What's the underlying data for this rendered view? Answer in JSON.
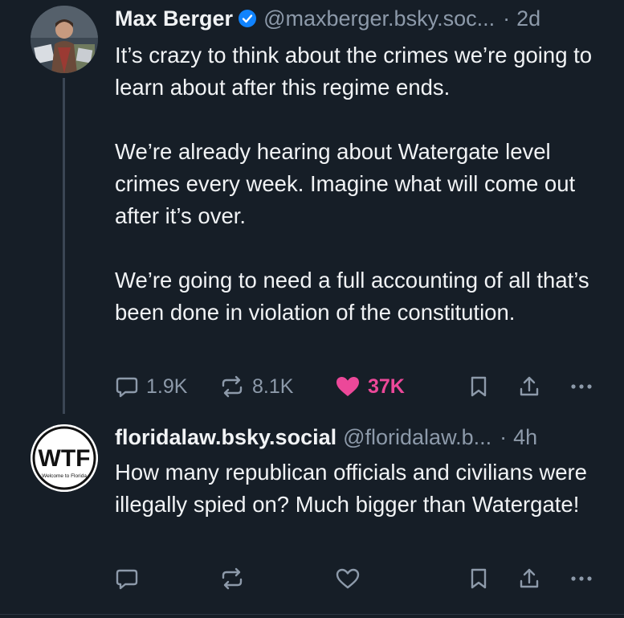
{
  "posts": [
    {
      "display_name": "Max Berger",
      "verified": true,
      "handle": "@maxberger.bsky.soc...",
      "separator": "·",
      "time": "2d",
      "paragraphs": [
        "It’s crazy to think about the crimes we’re going to learn about after this regime ends.",
        "We’re already hearing about Watergate level crimes every week. Imagine what will come out after it’s over.",
        "We’re going to need a full accounting of all that’s been done in violation of the constitution."
      ],
      "actions": {
        "reply_count": "1.9K",
        "repost_count": "8.1K",
        "like_count": "37K",
        "liked": true
      }
    },
    {
      "display_name": "floridalaw.bsky.social",
      "verified": false,
      "handle": "@floridalaw.b...",
      "separator": "·",
      "time": "4h",
      "avatar_text": "WTF",
      "avatar_subtext": "Welcome to Florida",
      "paragraphs": [
        "How many republican officials and civilians were illegally spied on? Much bigger than Watergate!"
      ],
      "actions": {
        "reply_count": "",
        "repost_count": "",
        "like_count": "",
        "liked": false
      }
    }
  ],
  "colors": {
    "background": "#161e27",
    "text": "#f1f3f5",
    "muted": "#8d9aaa",
    "like": "#ec4899",
    "verified": "#1083fe"
  },
  "icons": [
    "reply-icon",
    "repost-icon",
    "heart-icon",
    "bookmark-icon",
    "share-icon",
    "more-icon",
    "verified-badge-icon"
  ]
}
